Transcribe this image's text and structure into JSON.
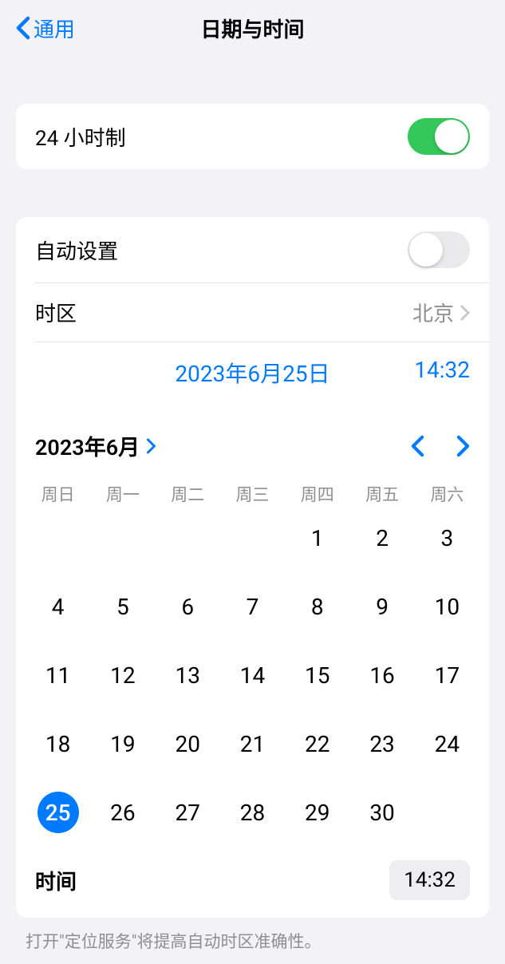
{
  "header": {
    "back_label": "通用",
    "title": "日期与时间"
  },
  "settings": {
    "twentyfour_hour_label": "24 小时制",
    "twentyfour_hour_enabled": true,
    "auto_set_label": "自动设置",
    "auto_set_enabled": false,
    "timezone_label": "时区",
    "timezone_value": "北京"
  },
  "datetime_display": {
    "date": "2023年6月25日",
    "time": "14:32"
  },
  "calendar": {
    "month_year": "2023年6月",
    "weekdays": [
      "周日",
      "周一",
      "周二",
      "周三",
      "周四",
      "周五",
      "周六"
    ],
    "leading_empty": 4,
    "days_in_month": 30,
    "selected_day": 25
  },
  "time_row": {
    "label": "时间",
    "value": "14:32"
  },
  "footer": {
    "note": "打开\"定位服务\"将提高自动时区准确性。"
  }
}
